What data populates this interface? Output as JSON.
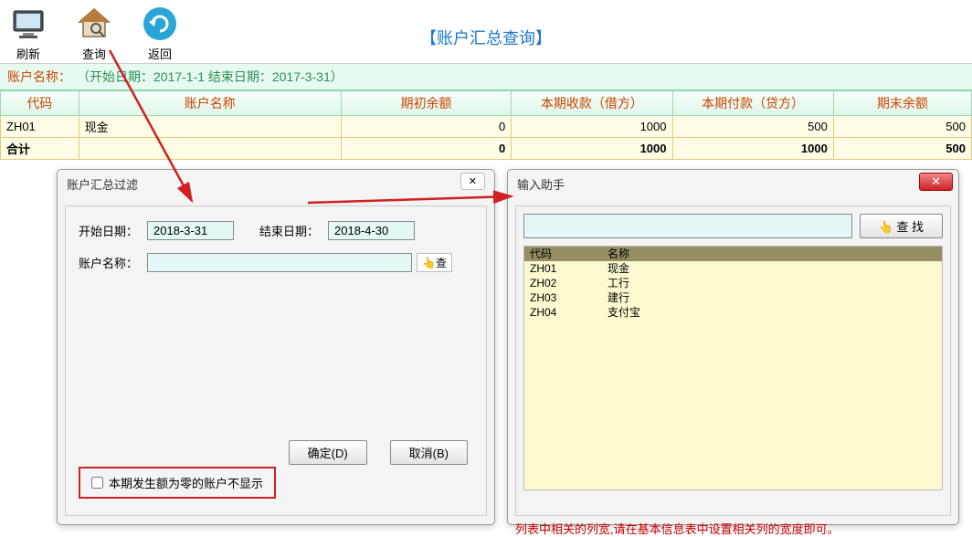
{
  "toolbar": {
    "refresh": "刷新",
    "query": "查询",
    "back": "返回"
  },
  "page_title": "【账户汇总查询】",
  "filter_bar": {
    "label": "账户名称：",
    "value": "（开始日期：2017-1-1 结束日期：2017-3-31）"
  },
  "table": {
    "headers": [
      "代码",
      "账户名称",
      "期初余额",
      "本期收款（借方）",
      "本期付款（贷方）",
      "期末余额"
    ],
    "rows": [
      {
        "code": "ZH01",
        "name": "现金",
        "open": "0",
        "debit": "1000",
        "credit": "500",
        "close": "500"
      }
    ],
    "total": {
      "label": "合计",
      "open": "0",
      "debit": "1000",
      "credit": "1000",
      "close": "500"
    }
  },
  "filter_dialog": {
    "title": "账户汇总过滤",
    "close": "✕",
    "start_label": "开始日期：",
    "start_value": "2018-3-31",
    "end_label": "结束日期：",
    "end_value": "2018-4-30",
    "name_label": "账户名称：",
    "name_value": "",
    "lookup_text": "👆查",
    "ok": "确定(D)",
    "cancel": "取消(B)",
    "checkbox_label": "本期发生额为零的账户不显示"
  },
  "helper_dialog": {
    "title": "输入助手",
    "close": "✕",
    "search_value": "",
    "search_btn": "👆 查  找",
    "list_headers": [
      "代码",
      "名称"
    ],
    "items": [
      {
        "code": "ZH01",
        "name": "现金"
      },
      {
        "code": "ZH02",
        "name": "工行"
      },
      {
        "code": "ZH03",
        "name": "建行"
      },
      {
        "code": "ZH04",
        "name": "支付宝"
      }
    ]
  },
  "footer": "列表中相关的列宽,请在基本信息表中设置相关列的宽度即可。"
}
